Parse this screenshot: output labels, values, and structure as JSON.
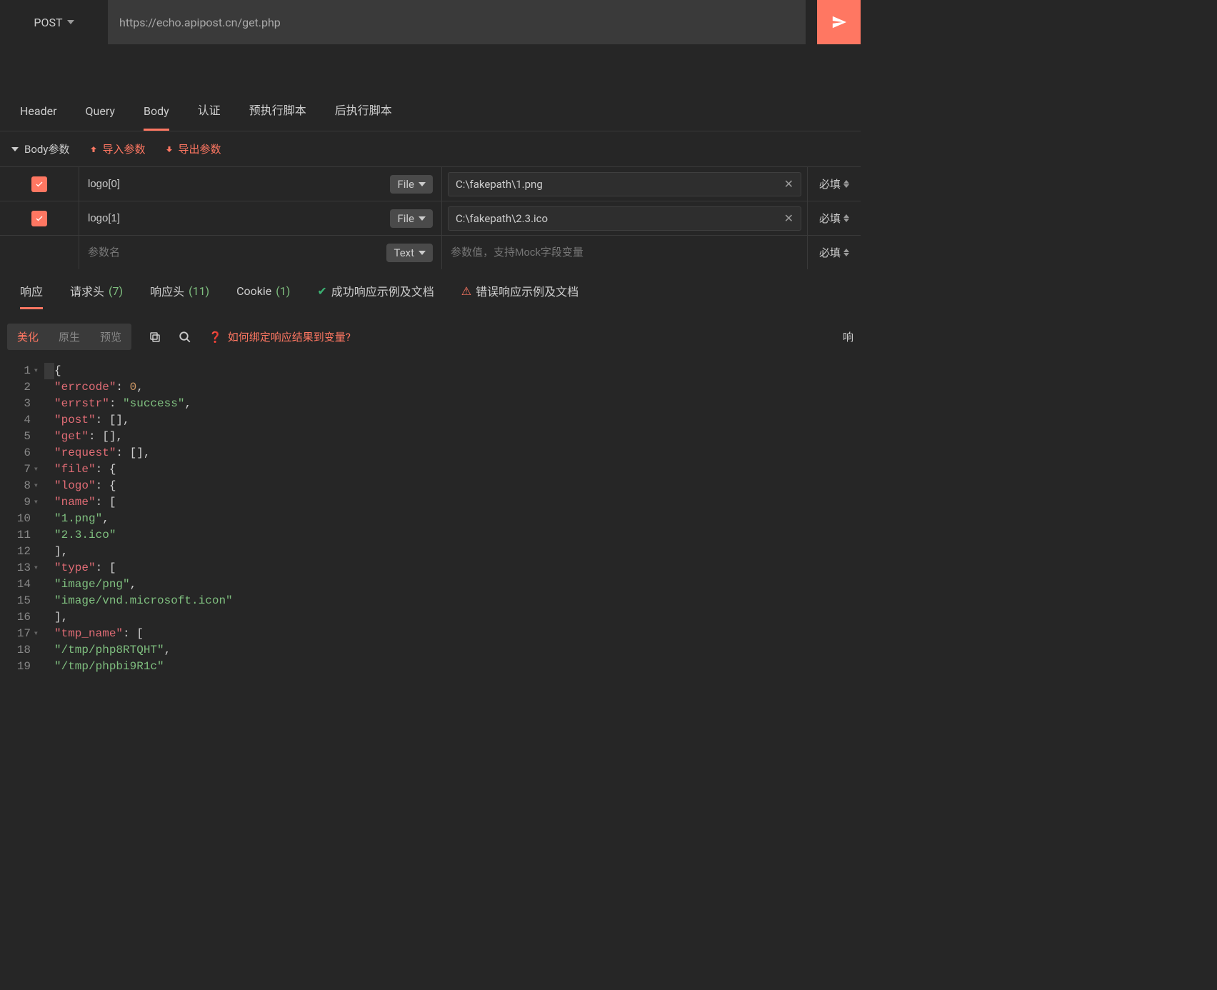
{
  "request": {
    "method": "POST",
    "url": "https://echo.apipost.cn/get.php"
  },
  "tabs": {
    "header": "Header",
    "query": "Query",
    "body": "Body",
    "auth": "认证",
    "prescript": "预执行脚本",
    "postscript": "后执行脚本"
  },
  "bodyHeader": {
    "title": "Body参数",
    "import": "导入参数",
    "export": "导出参数"
  },
  "typeLabels": {
    "file": "File",
    "text": "Text"
  },
  "requiredLabel": "必填",
  "paramNamePlaceholder": "参数名",
  "paramValuePlaceholder": "参数值，支持Mock字段变量",
  "params": [
    {
      "name": "logo[0]",
      "type": "File",
      "value": "C:\\fakepath\\1.png"
    },
    {
      "name": "logo[1]",
      "type": "File",
      "value": "C:\\fakepath\\2.3.ico"
    }
  ],
  "respTabs": {
    "response": "响应",
    "reqHeaders": "请求头",
    "reqHeadersCount": "(7)",
    "respHeaders": "响应头",
    "respHeadersCount": "(11)",
    "cookie": "Cookie",
    "cookieCount": "(1)",
    "successDoc": "成功响应示例及文档",
    "errorDoc": "错误响应示例及文档"
  },
  "respToolbar": {
    "beautify": "美化",
    "raw": "原生",
    "preview": "预览",
    "help": "如何绑定响应结果到变量?",
    "right": "响"
  },
  "code": {
    "lines": [
      {
        "n": 1,
        "fold": true,
        "tokens": [
          [
            "p",
            "{"
          ]
        ]
      },
      {
        "n": 2,
        "fold": false,
        "tokens": [
          [
            "p",
            "    "
          ],
          [
            "k",
            "\"errcode\""
          ],
          [
            "p",
            ": "
          ],
          [
            "n",
            "0"
          ],
          [
            "p",
            ","
          ]
        ]
      },
      {
        "n": 3,
        "fold": false,
        "tokens": [
          [
            "p",
            "    "
          ],
          [
            "k",
            "\"errstr\""
          ],
          [
            "p",
            ": "
          ],
          [
            "s",
            "\"success\""
          ],
          [
            "p",
            ","
          ]
        ]
      },
      {
        "n": 4,
        "fold": false,
        "tokens": [
          [
            "p",
            "    "
          ],
          [
            "k",
            "\"post\""
          ],
          [
            "p",
            ": [],"
          ]
        ]
      },
      {
        "n": 5,
        "fold": false,
        "tokens": [
          [
            "p",
            "    "
          ],
          [
            "k",
            "\"get\""
          ],
          [
            "p",
            ": [],"
          ]
        ]
      },
      {
        "n": 6,
        "fold": false,
        "tokens": [
          [
            "p",
            "    "
          ],
          [
            "k",
            "\"request\""
          ],
          [
            "p",
            ": [],"
          ]
        ]
      },
      {
        "n": 7,
        "fold": true,
        "tokens": [
          [
            "p",
            "    "
          ],
          [
            "k",
            "\"file\""
          ],
          [
            "p",
            ": {"
          ]
        ]
      },
      {
        "n": 8,
        "fold": true,
        "tokens": [
          [
            "p",
            "        "
          ],
          [
            "k",
            "\"logo\""
          ],
          [
            "p",
            ": {"
          ]
        ]
      },
      {
        "n": 9,
        "fold": true,
        "tokens": [
          [
            "p",
            "            "
          ],
          [
            "k",
            "\"name\""
          ],
          [
            "p",
            ": ["
          ]
        ]
      },
      {
        "n": 10,
        "fold": false,
        "tokens": [
          [
            "p",
            "                "
          ],
          [
            "s",
            "\"1.png\""
          ],
          [
            "p",
            ","
          ]
        ]
      },
      {
        "n": 11,
        "fold": false,
        "tokens": [
          [
            "p",
            "                "
          ],
          [
            "s",
            "\"2.3.ico\""
          ]
        ]
      },
      {
        "n": 12,
        "fold": false,
        "tokens": [
          [
            "p",
            "            ],"
          ]
        ]
      },
      {
        "n": 13,
        "fold": true,
        "tokens": [
          [
            "p",
            "            "
          ],
          [
            "k",
            "\"type\""
          ],
          [
            "p",
            ": ["
          ]
        ]
      },
      {
        "n": 14,
        "fold": false,
        "tokens": [
          [
            "p",
            "                "
          ],
          [
            "s",
            "\"image/png\""
          ],
          [
            "p",
            ","
          ]
        ]
      },
      {
        "n": 15,
        "fold": false,
        "tokens": [
          [
            "p",
            "                "
          ],
          [
            "s",
            "\"image/vnd.microsoft.icon\""
          ]
        ]
      },
      {
        "n": 16,
        "fold": false,
        "tokens": [
          [
            "p",
            "            ],"
          ]
        ]
      },
      {
        "n": 17,
        "fold": true,
        "tokens": [
          [
            "p",
            "            "
          ],
          [
            "k",
            "\"tmp_name\""
          ],
          [
            "p",
            ": ["
          ]
        ]
      },
      {
        "n": 18,
        "fold": false,
        "tokens": [
          [
            "p",
            "                "
          ],
          [
            "s",
            "\"/tmp/php8RTQHT\""
          ],
          [
            "p",
            ","
          ]
        ]
      },
      {
        "n": 19,
        "fold": false,
        "tokens": [
          [
            "p",
            "                "
          ],
          [
            "s",
            "\"/tmp/phpbi9R1c\""
          ]
        ]
      }
    ]
  }
}
